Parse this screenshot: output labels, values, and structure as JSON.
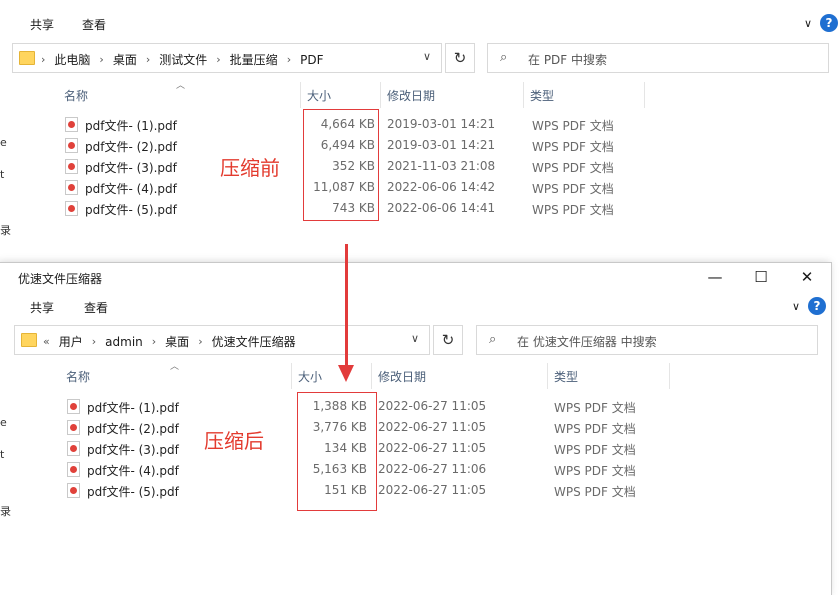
{
  "window1": {
    "ribbon": {
      "share": "共享",
      "view": "查看"
    },
    "address": {
      "crumbs": [
        "此电脑",
        "桌面",
        "测试文件",
        "批量压缩",
        "PDF"
      ]
    },
    "search_placeholder": "在 PDF 中搜索",
    "columns": {
      "name": "名称",
      "size": "大小",
      "date": "修改日期",
      "type": "类型"
    },
    "files": [
      {
        "name": "pdf文件- (1).pdf",
        "size": "4,664 KB",
        "date": "2019-03-01 14:21",
        "type": "WPS PDF 文档"
      },
      {
        "name": "pdf文件- (2).pdf",
        "size": "6,494 KB",
        "date": "2019-03-01 14:21",
        "type": "WPS PDF 文档"
      },
      {
        "name": "pdf文件- (3).pdf",
        "size": "352 KB",
        "date": "2021-11-03 21:08",
        "type": "WPS PDF 文档"
      },
      {
        "name": "pdf文件- (4).pdf",
        "size": "11,087 KB",
        "date": "2022-06-06 14:42",
        "type": "WPS PDF 文档"
      },
      {
        "name": "pdf文件- (5).pdf",
        "size": "743 KB",
        "date": "2022-06-06 14:41",
        "type": "WPS PDF 文档"
      }
    ],
    "annotation": "压缩前"
  },
  "window2": {
    "title": "优速文件压缩器",
    "ribbon": {
      "share": "共享",
      "view": "查看"
    },
    "address": {
      "prefix": "«",
      "crumbs": [
        "用户",
        "admin",
        "桌面",
        "优速文件压缩器"
      ]
    },
    "search_placeholder": "在 优速文件压缩器 中搜索",
    "columns": {
      "name": "名称",
      "size": "大小",
      "date": "修改日期",
      "type": "类型"
    },
    "files": [
      {
        "name": "pdf文件- (1).pdf",
        "size": "1,388 KB",
        "date": "2022-06-27 11:05",
        "type": "WPS PDF 文档"
      },
      {
        "name": "pdf文件- (2).pdf",
        "size": "3,776 KB",
        "date": "2022-06-27 11:05",
        "type": "WPS PDF 文档"
      },
      {
        "name": "pdf文件- (3).pdf",
        "size": "134 KB",
        "date": "2022-06-27 11:05",
        "type": "WPS PDF 文档"
      },
      {
        "name": "pdf文件- (4).pdf",
        "size": "5,163 KB",
        "date": "2022-06-27 11:06",
        "type": "WPS PDF 文档"
      },
      {
        "name": "pdf文件- (5).pdf",
        "size": "151 KB",
        "date": "2022-06-27 11:05",
        "type": "WPS PDF 文档"
      }
    ],
    "annotation": "压缩后"
  },
  "nav_fragments": [
    "e",
    "t",
    "录",
    "e",
    "t",
    "录"
  ],
  "icons": {
    "refresh": "refresh-icon",
    "search": "search-icon",
    "folder": "folder-icon",
    "pdf": "pdf-file-icon",
    "help": "help-icon"
  },
  "colors": {
    "annotation_red": "#e23b3b",
    "help_blue": "#1f6fd1",
    "header_text": "#4c607a"
  }
}
